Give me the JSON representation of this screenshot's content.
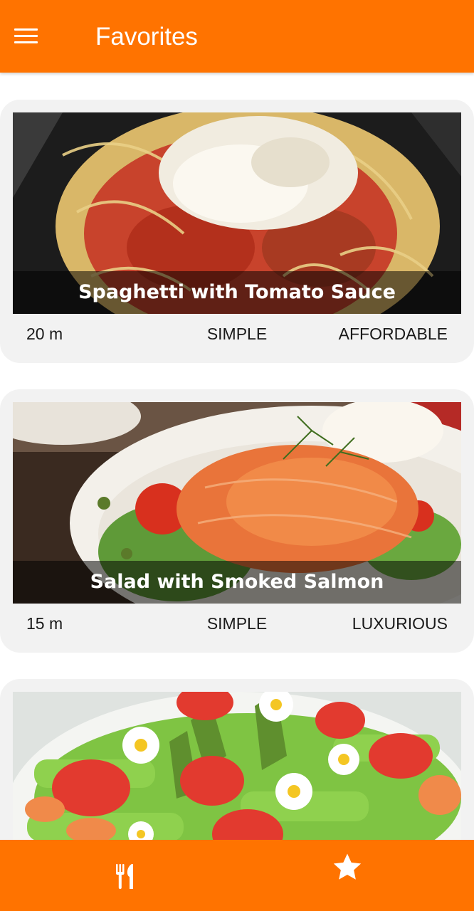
{
  "appbar": {
    "title": "Favorites",
    "menu_icon": "hamburger-menu-icon"
  },
  "meals": [
    {
      "title": "Spaghetti with Tomato Sauce",
      "duration": "20 m",
      "complexity": "SIMPLE",
      "affordability": "AFFORDABLE"
    },
    {
      "title": "Salad with Smoked Salmon",
      "duration": "15 m",
      "complexity": "SIMPLE",
      "affordability": "LUXURIOUS"
    },
    {
      "title": "",
      "duration": "",
      "complexity": "",
      "affordability": ""
    }
  ],
  "bottom_tabs": [
    {
      "name": "categories",
      "icon": "restaurant-icon",
      "active": false
    },
    {
      "name": "favorites",
      "icon": "star-icon",
      "active": true
    }
  ],
  "colors": {
    "primary": "#ff7300",
    "card": "#f2f2f2",
    "on_primary": "#ffffff"
  }
}
